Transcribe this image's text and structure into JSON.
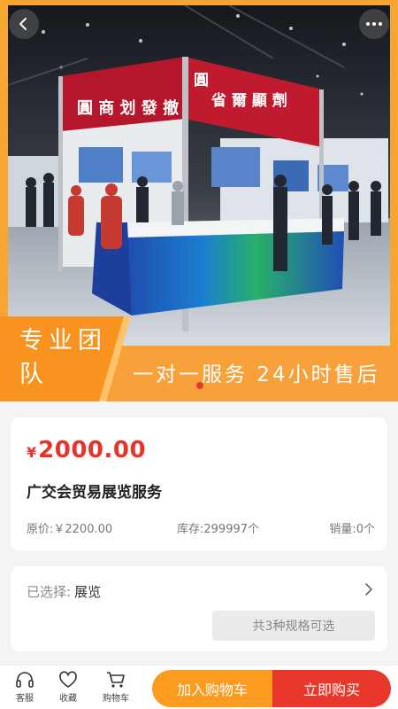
{
  "hero": {
    "booth_sign_left": "圓 商 划 發 撤",
    "booth_sign_right": "省 爾 顯 劑",
    "booth_sign_center": "圓",
    "banner_left": "专业团队",
    "banner_right": "一对一服务 24小时售后"
  },
  "product": {
    "currency": "¥",
    "price": "2000.00",
    "title": "广交会贸易展览服务",
    "original_price": "原价:￥2200.00",
    "stock": "库存:299997个",
    "sales": "销量:0个"
  },
  "spec": {
    "selected_label": "已选择:",
    "selected_value": "展览",
    "options_button": "共3种规格可选"
  },
  "bottom_bar": {
    "service_label": "客服",
    "favorite_label": "收藏",
    "cart_label": "购物车",
    "add_to_cart": "加入购物车",
    "buy_now": "立即购买"
  },
  "icons": {
    "back": "chevron-left-icon",
    "more": "more-icon",
    "service": "headset-icon",
    "favorite": "heart-icon",
    "cart": "cart-icon",
    "chevron": "chevron-right-icon"
  },
  "colors": {
    "accent_orange": "#fb9b1f",
    "accent_red": "#e9372b",
    "price_red": "#e8332a"
  }
}
